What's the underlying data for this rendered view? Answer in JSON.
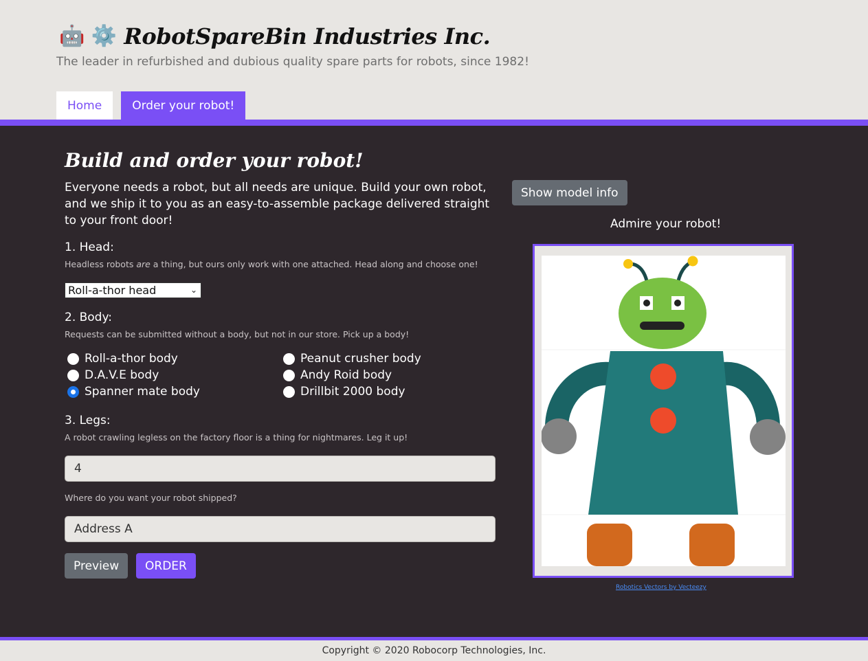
{
  "header": {
    "brand_emoji": "🤖 ⚙️",
    "title": "RobotSpareBin Industries Inc.",
    "tagline": "The leader in refurbished and dubious quality spare parts for robots, since 1982!"
  },
  "nav": {
    "home": "Home",
    "order": "Order your robot!"
  },
  "form": {
    "title": "Build and order your robot!",
    "intro": "Everyone needs a robot, but all needs are unique. Build your own robot, and we ship it to you as an easy-to-assemble package delivered straight to your front door!",
    "head": {
      "label": "1. Head:",
      "hint_before": "Headless robots ",
      "hint_em": "are",
      "hint_after": " a thing, but ours only work with one attached. Head along and choose one!",
      "selected": "Roll-a-thor head"
    },
    "body": {
      "label": "2. Body:",
      "hint": "Requests can be submitted without a body, but not in our store. Pick up a body!",
      "options": [
        "Roll-a-thor body",
        "Peanut crusher body",
        "D.A.V.E body",
        "Andy Roid body",
        "Spanner mate body",
        "Drillbit 2000 body"
      ],
      "selected": "Spanner mate body"
    },
    "legs": {
      "label": "3. Legs:",
      "hint": "A robot crawling legless on the factory floor is a thing for nightmares. Leg it up!",
      "value": "4"
    },
    "address": {
      "hint": "Where do you want your robot shipped?",
      "value": "Address A"
    },
    "preview_button": "Preview",
    "order_button": "ORDER"
  },
  "preview": {
    "model_info_button": "Show model info",
    "caption": "Admire your robot!",
    "credit": "Robotics Vectors by Vecteezy"
  },
  "footer": {
    "copyright": "Copyright © 2020 Robocorp Technologies, Inc."
  },
  "colors": {
    "accent": "#7a4ff5",
    "dark_bg": "#2e272c",
    "light_bg": "#e8e6e3",
    "robot_head": "#7ac143",
    "robot_body": "#227a7a",
    "robot_arms": "#1a6465",
    "robot_buttons": "#ee4b2b",
    "robot_hands": "#838383",
    "robot_feet": "#d2691e",
    "antenna_tip": "#f7c511"
  }
}
